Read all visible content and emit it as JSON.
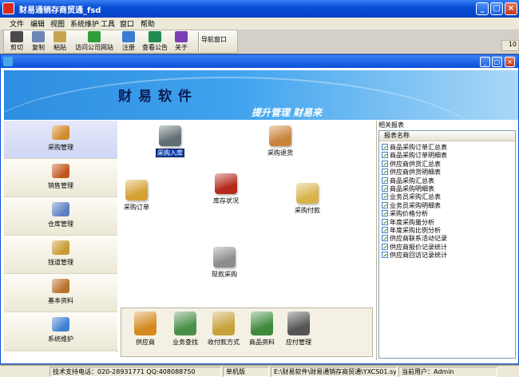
{
  "window": {
    "title": "财易通销存商贸通_fsd",
    "minimize": "_",
    "maximize": "□",
    "close": "×"
  },
  "menu": [
    "文件",
    "编辑",
    "视图",
    "系统维护",
    "工具",
    "窗口",
    "帮助"
  ],
  "toolbar": {
    "buttons": [
      {
        "label": "剪切",
        "icon": "scissors-icon",
        "color": "#4a4a4a"
      },
      {
        "label": "复制",
        "icon": "copy-icon",
        "color": "#6d86b5"
      },
      {
        "label": "粘贴",
        "icon": "paste-icon",
        "color": "#c9a44e"
      },
      {
        "label": "访问公司网站",
        "icon": "globe-network-icon",
        "color": "#2f9d3a"
      },
      {
        "label": "注册",
        "icon": "register-icon",
        "color": "#3b7bd1"
      },
      {
        "label": "查看公告",
        "icon": "globe-icon",
        "color": "#1d8c4e"
      },
      {
        "label": "关于",
        "icon": "help-icon",
        "color": "#7a3fb5"
      }
    ],
    "nav_window": "导航窗口",
    "right_partial": "10"
  },
  "banner": {
    "title": "财易软件",
    "slogan": "提升管理 财易来"
  },
  "nav": [
    {
      "label": "采购管理",
      "icon": "truck-icon",
      "color": "#d08a2b",
      "active": true
    },
    {
      "label": "销售管理",
      "icon": "sales-icon",
      "color": "#c2561e",
      "active": false
    },
    {
      "label": "仓库管理",
      "icon": "warehouse-icon",
      "color": "#5b7fc4",
      "active": false
    },
    {
      "label": "钱道管理",
      "icon": "ledger-icon",
      "color": "#c99a30",
      "active": false
    },
    {
      "label": "基本资料",
      "icon": "books-icon",
      "color": "#b8702a",
      "active": false
    },
    {
      "label": "系统维护",
      "icon": "tools-icon",
      "color": "#3d7fd0",
      "active": false
    }
  ],
  "center_icons": [
    {
      "label": "采购入库",
      "icon": "inbound-icon",
      "color": "#5f6f72"
    },
    {
      "label": "采购退货",
      "icon": "return-icon",
      "color": "#c9843b"
    },
    {
      "label": "采购订单",
      "icon": "order-icon",
      "color": "#d6a134"
    },
    {
      "label": "库存状况",
      "icon": "inventory-icon",
      "color": "#b52a1c"
    },
    {
      "label": "采购付款",
      "icon": "payment-icon",
      "color": "#d9b24a"
    },
    {
      "label": "现款采购",
      "icon": "cash-purchase-icon",
      "color": "#8d8d8d"
    }
  ],
  "bottom_icons": [
    {
      "label": "供应商",
      "icon": "supplier-icon",
      "color": "#d48a1f"
    },
    {
      "label": "业务查找",
      "icon": "search-icon",
      "color": "#4a8f4a"
    },
    {
      "label": "收付款方式",
      "icon": "money-bag-icon",
      "color": "#c7a13a"
    },
    {
      "label": "商品资料",
      "icon": "goods-icon",
      "color": "#3f8a3f"
    },
    {
      "label": "应付管理",
      "icon": "payable-icon",
      "color": "#555555"
    }
  ],
  "reports": {
    "caption": "相关报表",
    "header": "报表名称",
    "items": [
      "商品采购订单汇总表",
      "商品采购订单明细表",
      "供应商供货汇总表",
      "供应商供货明细表",
      "商品采购汇总表",
      "商品采购明细表",
      "业务员采购汇总表",
      "业务员采购明细表",
      "采购价格分析",
      "年度采购量分析",
      "年度采购比例分析",
      "供应商联系活动记录",
      "供应商报价记录统计",
      "供应商回访记录统计"
    ]
  },
  "status": {
    "support": "技术支持电话：020-28931771 QQ:408088750",
    "edition": "单机版",
    "path": "E:\\财易软件\\财易通销存商贸通\\YXCS01.sys",
    "user": "当前用户：Admin"
  }
}
